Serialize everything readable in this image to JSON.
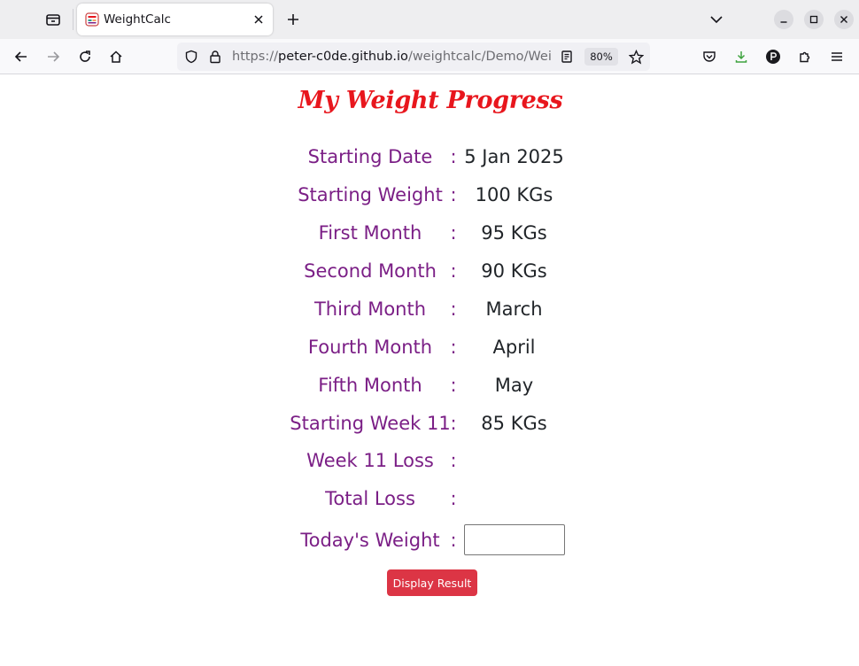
{
  "browser": {
    "tab_title": "WeightCalc",
    "url_prefix": "https://",
    "url_host": "peter-c0de.github.io",
    "url_path": "/weightcalc/Demo/Weig",
    "zoom": "80%"
  },
  "page": {
    "title": "My Weight Progress",
    "colon": ":",
    "rows": [
      {
        "label": "Starting Date",
        "value": "5 Jan 2025"
      },
      {
        "label": "Starting Weight",
        "value": "100 KGs"
      },
      {
        "label": "First Month",
        "value": "95 KGs"
      },
      {
        "label": "Second Month",
        "value": "90 KGs"
      },
      {
        "label": "Third Month",
        "value": "March"
      },
      {
        "label": "Fourth Month",
        "value": "April"
      },
      {
        "label": "Fifth Month",
        "value": "May"
      },
      {
        "label": "Starting Week 11",
        "value": "85 KGs"
      },
      {
        "label": "Week 11 Loss",
        "value": ""
      },
      {
        "label": "Total Loss",
        "value": ""
      },
      {
        "label": "Today's Weight",
        "value": ""
      }
    ],
    "todays_weight_value": "",
    "display_button": "Display Result"
  },
  "colors": {
    "title": "#e8161d",
    "label": "#7b1f86",
    "value": "#212529",
    "button": "#dc3545"
  }
}
